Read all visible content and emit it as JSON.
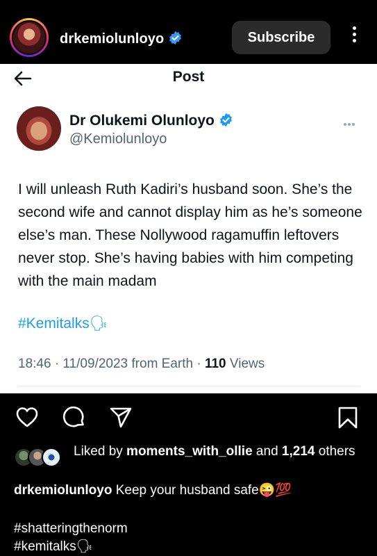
{
  "header": {
    "username": "drkemiolunloyo",
    "verified": true,
    "subscribe_label": "Subscribe",
    "more_icon": "vertical-ellipsis-icon"
  },
  "post_card": {
    "title": "Post",
    "back_icon": "arrow-left-icon",
    "author_name": "Dr Olukemi Olunloyo",
    "author_handle": "@Kemiolunloyo",
    "more_icon": "horizontal-ellipsis-icon",
    "text": "I will unleash Ruth Kadiri’s husband soon. She’s the second wife and cannot display him as he’s someone else’s man. These Nollywood ragamuffin leftovers never stop. She’s having babies with him competing with the main madam",
    "hashtag": "#Kemitalks🗣",
    "timestamp": "18:46 · 11/09/2023 from Earth · ",
    "views_count": "110",
    "views_label": " Views",
    "hashtag_color": "#1d9bf0"
  },
  "actions": {
    "like_icon": "heart-icon",
    "comment_icon": "comment-icon",
    "share_icon": "send-icon",
    "save_icon": "bookmark-icon"
  },
  "likes": {
    "prefix": "Liked by ",
    "user": "moments_with_ollie",
    "middle": " and ",
    "count": "1,214",
    "suffix": " others"
  },
  "caption": {
    "username": "drkemiolunloyo",
    "text": " Keep your husband safe😜💯"
  },
  "tags": {
    "line1": "#shatteringthenorm",
    "line2": "#kemitalks🗣"
  }
}
